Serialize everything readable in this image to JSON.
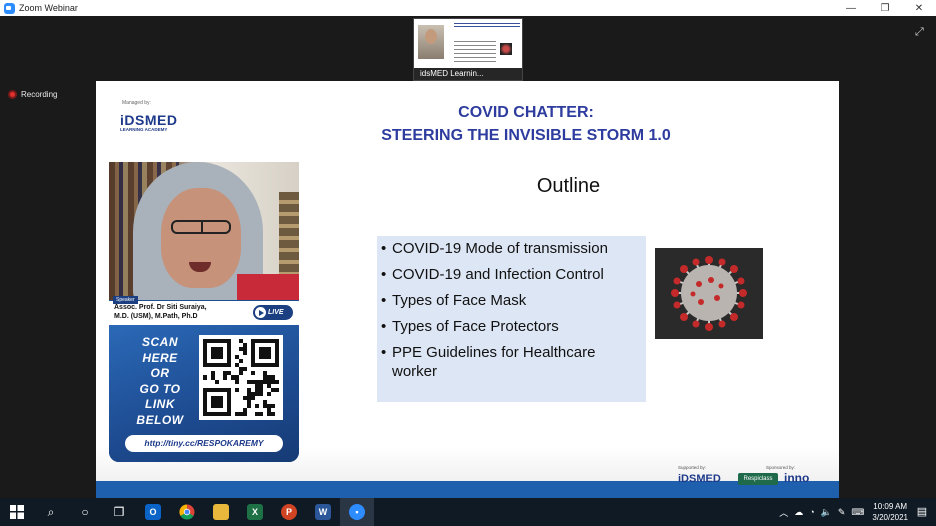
{
  "window": {
    "title": "Zoom Webinar",
    "minimize": "—",
    "restore": "❐",
    "close": "✕"
  },
  "thumbnail": {
    "label": "idsMED Learnin..."
  },
  "recording": {
    "label": "Recording"
  },
  "slide": {
    "managed_by": "Managed by:",
    "logo_word": "iDSMED",
    "logo_sub": "LEARNING ACADEMY",
    "title_line1": "COVID CHATTER:",
    "title_line2": "STEERING THE INVISIBLE STORM 1.0",
    "heading": "Outline",
    "bullets": [
      "COVID-19 Mode of transmission",
      "COVID-19 and Infection Control",
      "Types of Face Mask",
      "Types of Face Protectors",
      "PPE Guidelines for Healthcare worker"
    ],
    "supported_by": "Supported by:",
    "supported_logo": "iDSMED",
    "sponsored_by": "Sponsored by:",
    "sponsor1": "Respiclass",
    "sponsor2": "inno"
  },
  "speaker": {
    "tag": "Speaker",
    "name_line1": "Assoc. Prof. Dr Siti Suraiya,",
    "name_line2": "M.D. (USM), M.Path, Ph.D",
    "live": "LIVE",
    "scan_lines": [
      "SCAN",
      "HERE",
      "OR",
      "GO TO",
      "LINK",
      "BELOW"
    ],
    "link": "http://tiny.cc/RESPOKAREMY"
  },
  "taskbar": {
    "time": "10:09 AM",
    "date": "3/20/2021"
  },
  "colors": {
    "title_blue": "#2d3c9e",
    "bullet_box": "#dde6f4",
    "panel_blue": "#1f4f93",
    "taskbar": "#0f1a24",
    "record_red": "#e0312f"
  }
}
